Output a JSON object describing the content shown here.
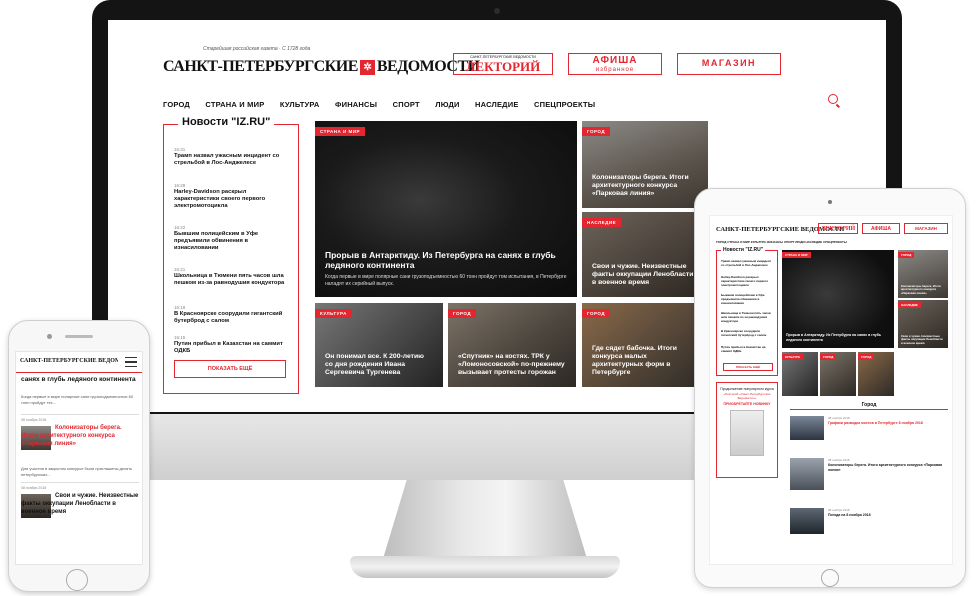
{
  "site": {
    "logo_text": "САНКТ-ПЕТЕРБУРГСКИЕ ВЕДОМОСТИ",
    "logo_tagline": "Старейшая российская газета · С 1728 года",
    "logo_star": "✲",
    "lektory_small": "САНКТ-ПЕТЕРБУРГСКИЕ ВЕДОМОСТИ",
    "lektory": "ЛЕКТОРИЙ",
    "afisha": "АФИША",
    "afisha_sub": "избранное",
    "shop": "МАГАЗИН"
  },
  "nav": [
    "ГОРОД",
    "СТРАНА И МИР",
    "КУЛЬТУРА",
    "ФИНАНСЫ",
    "СПОРТ",
    "ЛЮДИ",
    "НАСЛЕДИЕ",
    "СПЕЦПРОЕКТЫ"
  ],
  "news": {
    "title": "Новости \"IZ.RU\"",
    "more": "ПОКАЗАТЬ ЕЩЁ",
    "items": [
      {
        "time": "16:31",
        "text": "Трамп назвал ужасным инцидент со стрельбой в Лос-Анджелесе"
      },
      {
        "time": "16:28",
        "text": "Harley-Davidson раскрыл характеристики своего первого электромотоцикла"
      },
      {
        "time": "16:22",
        "text": "Бывшим полицейским в Уфе предъявили обвинения в изнасиловании"
      },
      {
        "time": "16:21",
        "text": "Школьница в Тюмени пять часов шла пешком из-за равнодушия кондуктора"
      },
      {
        "time": "16:19",
        "text": "В Красноярске соорудили гигантский бутерброд с салом"
      },
      {
        "time": "16:15",
        "text": "Путин прибыл в Казахстан на саммит ОДКБ"
      }
    ]
  },
  "articles": {
    "main": {
      "tag": "СТРАНА И МИР",
      "title": "Прорыв в Антарктиду. Из Петербурга на санях в глубь ледяного континента",
      "desc": "Когда первые в мире полярные сани грузоподъемностью 60 тонн пройдут том испытания, в Петербурге наладят их серийный выпуск."
    },
    "right1": {
      "tag": "ГОРОД",
      "title": "Колонизаторы берега. Итоги архитектурного конкурса «Парковая линия»"
    },
    "right2": {
      "tag": "НАСЛЕДИЕ",
      "title": "Свои и чужие. Неизвестные факты оккупации Ленобласти в военное время"
    },
    "b1": {
      "tag": "КУЛЬТУРА",
      "title": "Он понимал все. К 200-летию со дня рождения Ивана Сергеевича Тургенева"
    },
    "b2": {
      "tag": "ГОРОД",
      "title": "«Спутник» на костях. ТРК у «Ломоносовской» по-прежнему вызывает протесты горожан"
    },
    "b3": {
      "tag": "ГОРОД",
      "title": "Где сядет бабочка. Итоги конкурса малых архитектурных форм в Петербурге"
    }
  },
  "tablet": {
    "subscribe_title": "Продолжение популярного курса",
    "subscribe_sub": "«Лекторий «Санкт-Петербургские Ведомости»»",
    "subscribe_btn": "ПРИОБРЕТАЙТЕ НОВИНКУ",
    "section": "Город",
    "items": [
      {
        "date": "08 ноября 2018",
        "title": "Графики разводки мостов в Петербурге 8 ноября 2018"
      },
      {
        "date": "08 ноября 2018",
        "title": "Колонизаторы берега. Итоги архитектурного конкурса «Парковая линия»"
      },
      {
        "date": "08 ноября 2018",
        "title": "Погода на 8 ноября 2018"
      }
    ]
  },
  "phone": {
    "top_title": "санях в глубь ледяного континента",
    "top_desc": "Когда первые в мире полярные сани грузоподъемностью 60 тонн пройдут тех...",
    "items": [
      {
        "date": "08 ноября 2018",
        "title": "Колонизаторы берега. Итоги архитектурного конкурса «Парковая линия»",
        "desc": "Для участия в закрытом конкурсе были приглашены десять петербургских..."
      },
      {
        "date": "08 ноября 2018",
        "title": "Свои и чужие. Неизвестные факты оккупации Ленобласти в военное время",
        "desc": ""
      }
    ]
  },
  "colors": {
    "accent": "#e3262f",
    "bezel": "#141414"
  }
}
